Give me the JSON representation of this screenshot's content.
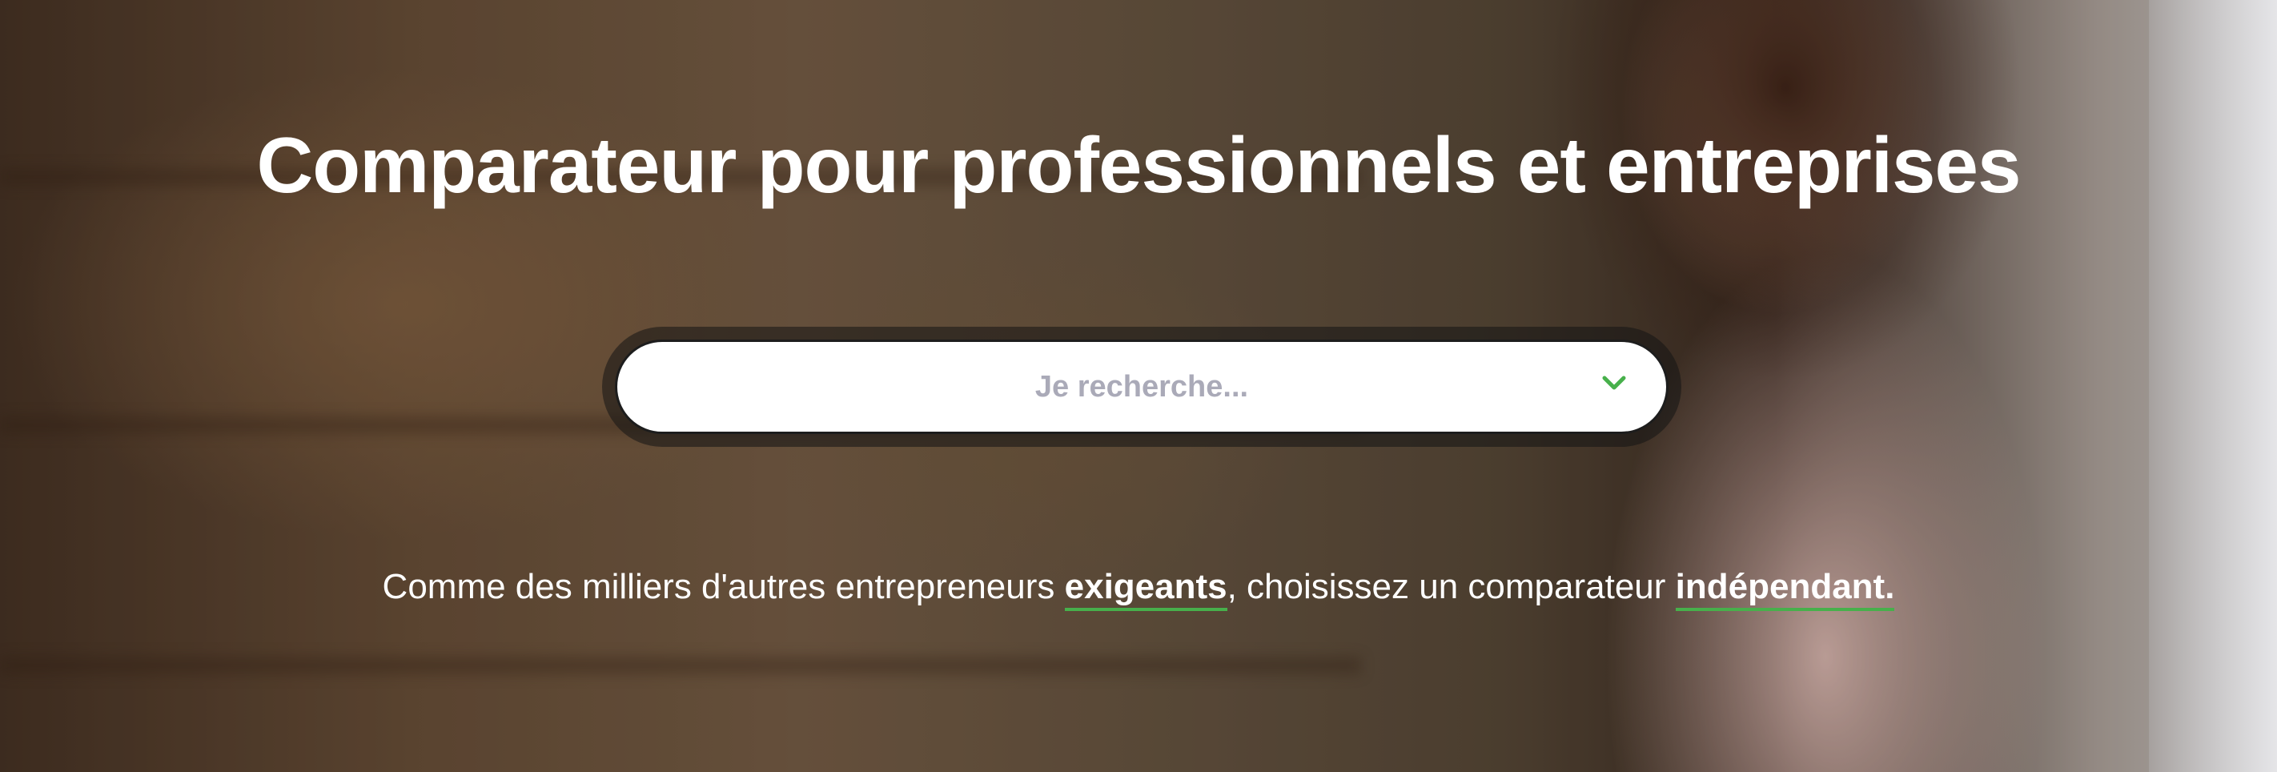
{
  "hero": {
    "title": "Comparateur pour professionnels et entreprises",
    "search": {
      "placeholder": "Je recherche...",
      "dropdown_icon": "chevron-down-icon"
    },
    "tagline": {
      "part1": "Comme des milliers d'autres entrepreneurs ",
      "emphasis1": "exigeants",
      "part2": ", choisissez un comparateur ",
      "emphasis2": "indépendant."
    }
  },
  "colors": {
    "accent_green": "#47b04b",
    "placeholder_text": "#aaaab8",
    "title_text": "#ffffff"
  }
}
